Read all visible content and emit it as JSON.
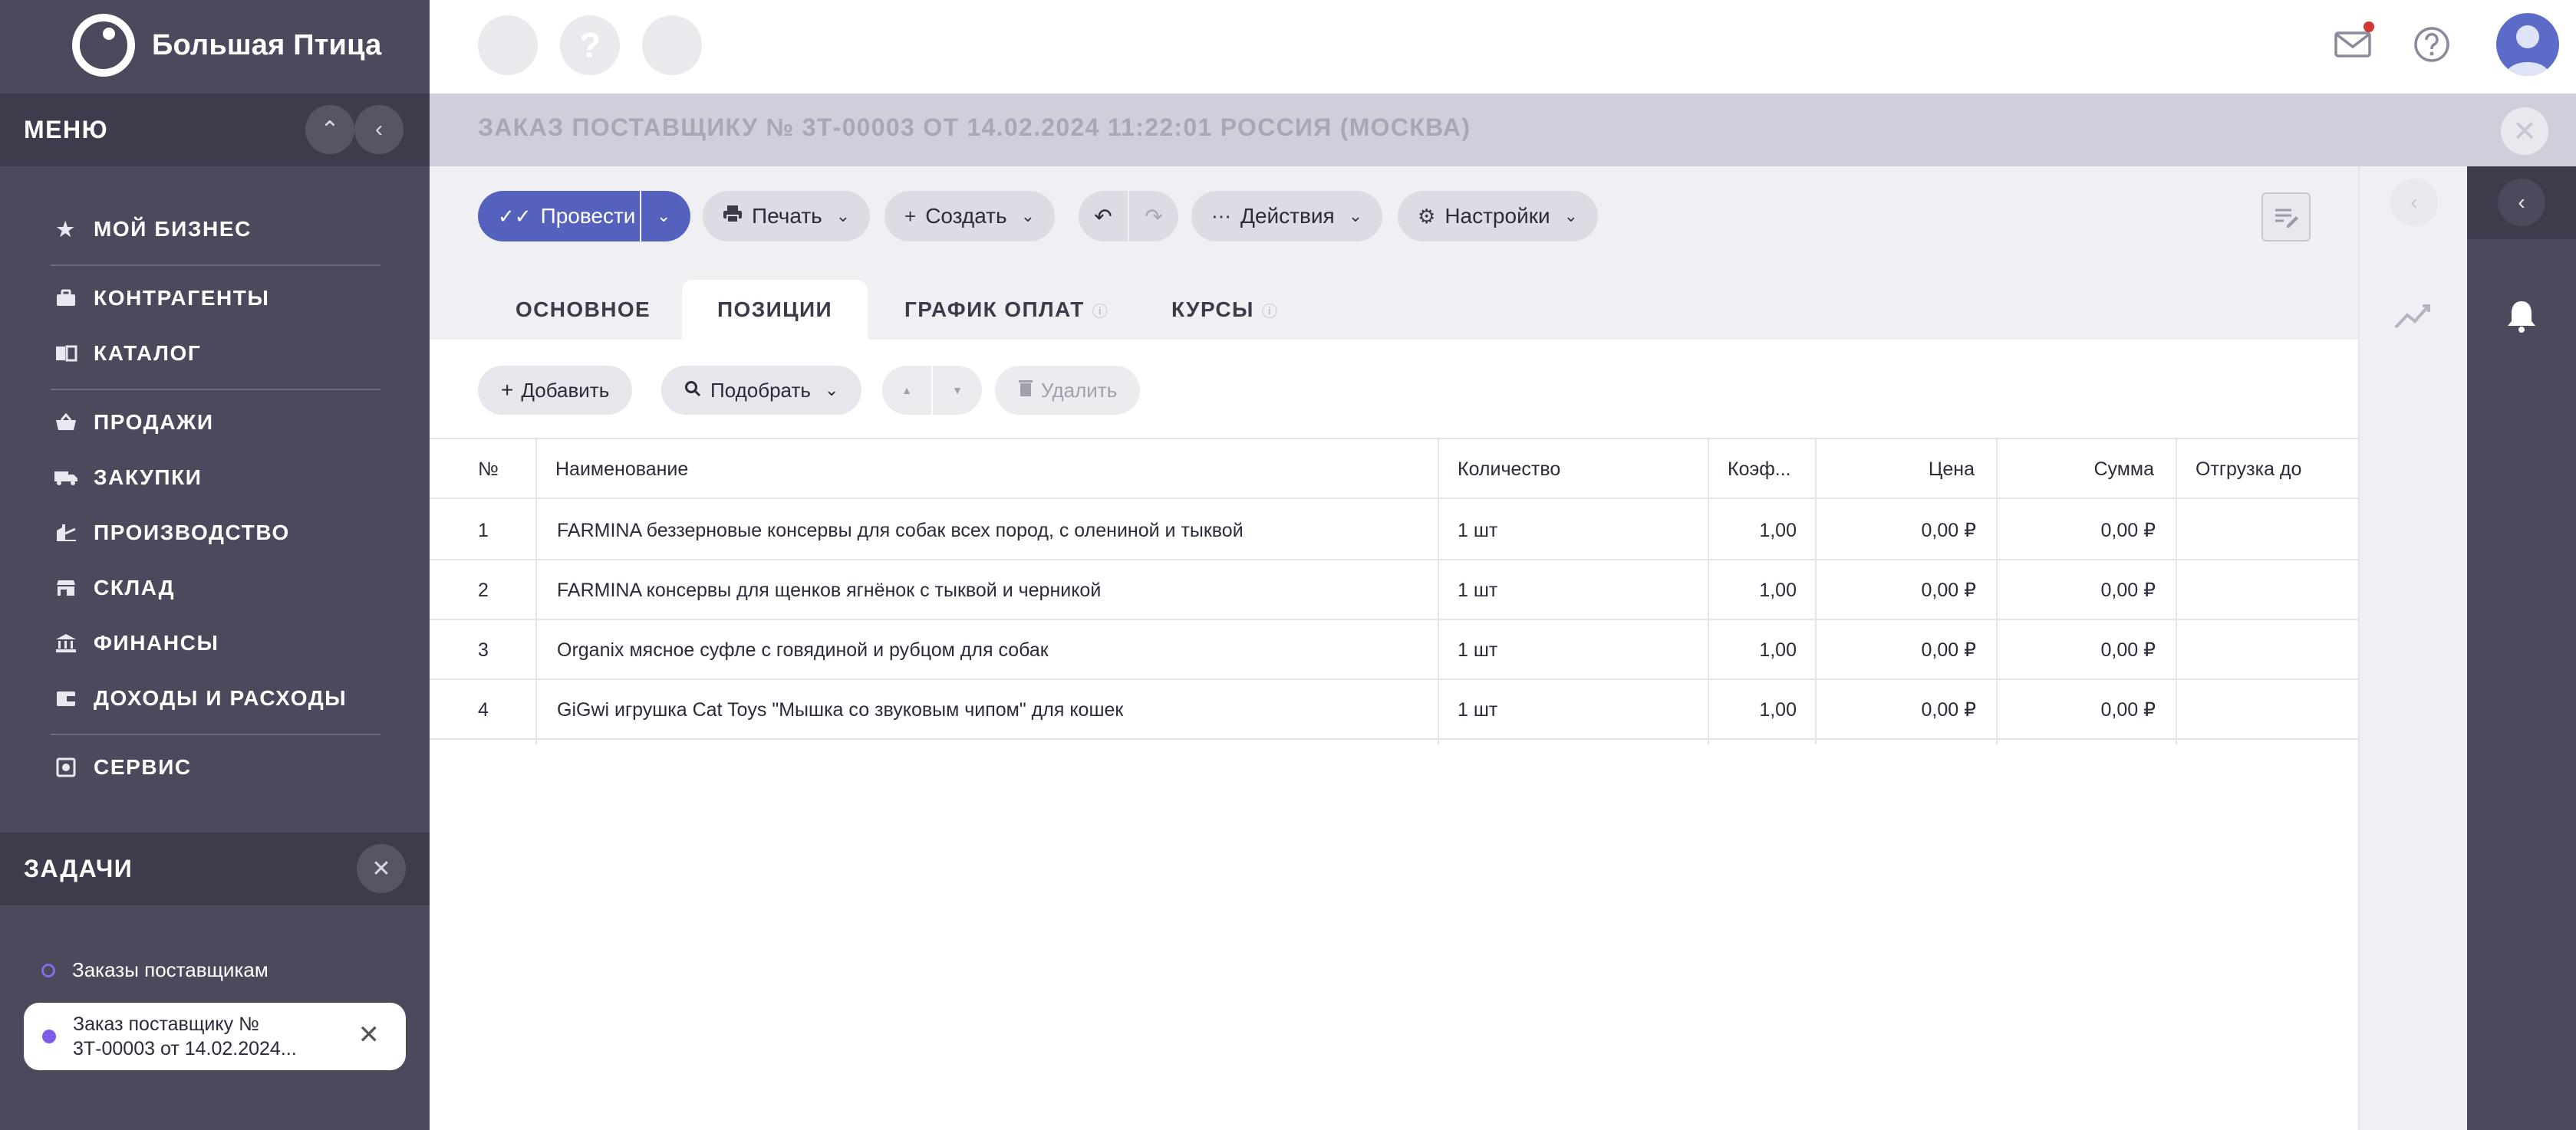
{
  "app": {
    "logo_text": "Большая Птица"
  },
  "sidebar": {
    "menu_title": "МЕНЮ",
    "items": [
      {
        "label": "МОЙ БИЗНЕС",
        "icon": "star-icon"
      },
      {
        "label": "КОНТРАГЕНТЫ",
        "icon": "briefcase-icon"
      },
      {
        "label": "КАТАЛОГ",
        "icon": "book-icon"
      },
      {
        "label": "ПРОДАЖИ",
        "icon": "basket-icon"
      },
      {
        "label": "ЗАКУПКИ",
        "icon": "truck-icon"
      },
      {
        "label": "ПРОИЗВОДСТВО",
        "icon": "factory-icon"
      },
      {
        "label": "СКЛАД",
        "icon": "warehouse-icon"
      },
      {
        "label": "ФИНАНСЫ",
        "icon": "bank-icon"
      },
      {
        "label": "ДОХОДЫ И РАСХОДЫ",
        "icon": "wallet-icon"
      },
      {
        "label": "СЕРВИС",
        "icon": "service-icon"
      }
    ],
    "tasks_title": "ЗАДАЧИ",
    "tasks": [
      {
        "label": "Заказы поставщикам"
      }
    ],
    "active_task": {
      "line1": "Заказ поставщику №",
      "line2": "3Т-00003 от 14.02.2024..."
    }
  },
  "topbar": {
    "ghost_icon_2": "?"
  },
  "document": {
    "title": "ЗАКАЗ ПОСТАВЩИКУ № 3Т-00003 ОТ 14.02.2024 11:22:01 РОССИЯ (МОСКВА)"
  },
  "toolbar": {
    "post": "Провести",
    "print": "Печать",
    "create": "Создать",
    "actions": "Действия",
    "settings": "Настройки"
  },
  "tabs": [
    {
      "label": "ОСНОВНОЕ"
    },
    {
      "label": "ПОЗИЦИИ",
      "active": true
    },
    {
      "label": "ГРАФИК ОПЛАТ"
    },
    {
      "label": "КУРСЫ"
    }
  ],
  "items_toolbar": {
    "add": "Добавить",
    "pick": "Подобрать",
    "delete": "Удалить"
  },
  "table": {
    "columns": [
      "№",
      "Наименование",
      "Количество",
      "Коэф...",
      "Цена",
      "Сумма",
      "Отгрузка до"
    ],
    "rows": [
      {
        "n": "1",
        "name": "FARMINA беззерновые консервы для собак всех пород, с олениной и тыквой",
        "qty": "1 шт",
        "coef": "1,00",
        "price": "0,00 ₽",
        "sum": "0,00 ₽",
        "ship": ""
      },
      {
        "n": "2",
        "name": "FARMINA консервы для щенков ягнёнок с тыквой и черникой",
        "qty": "1 шт",
        "coef": "1,00",
        "price": "0,00 ₽",
        "sum": "0,00 ₽",
        "ship": ""
      },
      {
        "n": "3",
        "name": "Organix мясное суфле с говядиной и рубцом для собак",
        "qty": "1 шт",
        "coef": "1,00",
        "price": "0,00 ₽",
        "sum": "0,00 ₽",
        "ship": ""
      },
      {
        "n": "4",
        "name": "GiGwi игрушка Cat Toys \"Мышка со звуковым чипом\" для кошек",
        "qty": "1 шт",
        "coef": "1,00",
        "price": "0,00 ₽",
        "sum": "0,00 ₽",
        "ship": ""
      }
    ]
  },
  "colors": {
    "accent": "#5562bd",
    "sidebar": "#4a4a5c",
    "notification_dot": "#d0372f"
  }
}
